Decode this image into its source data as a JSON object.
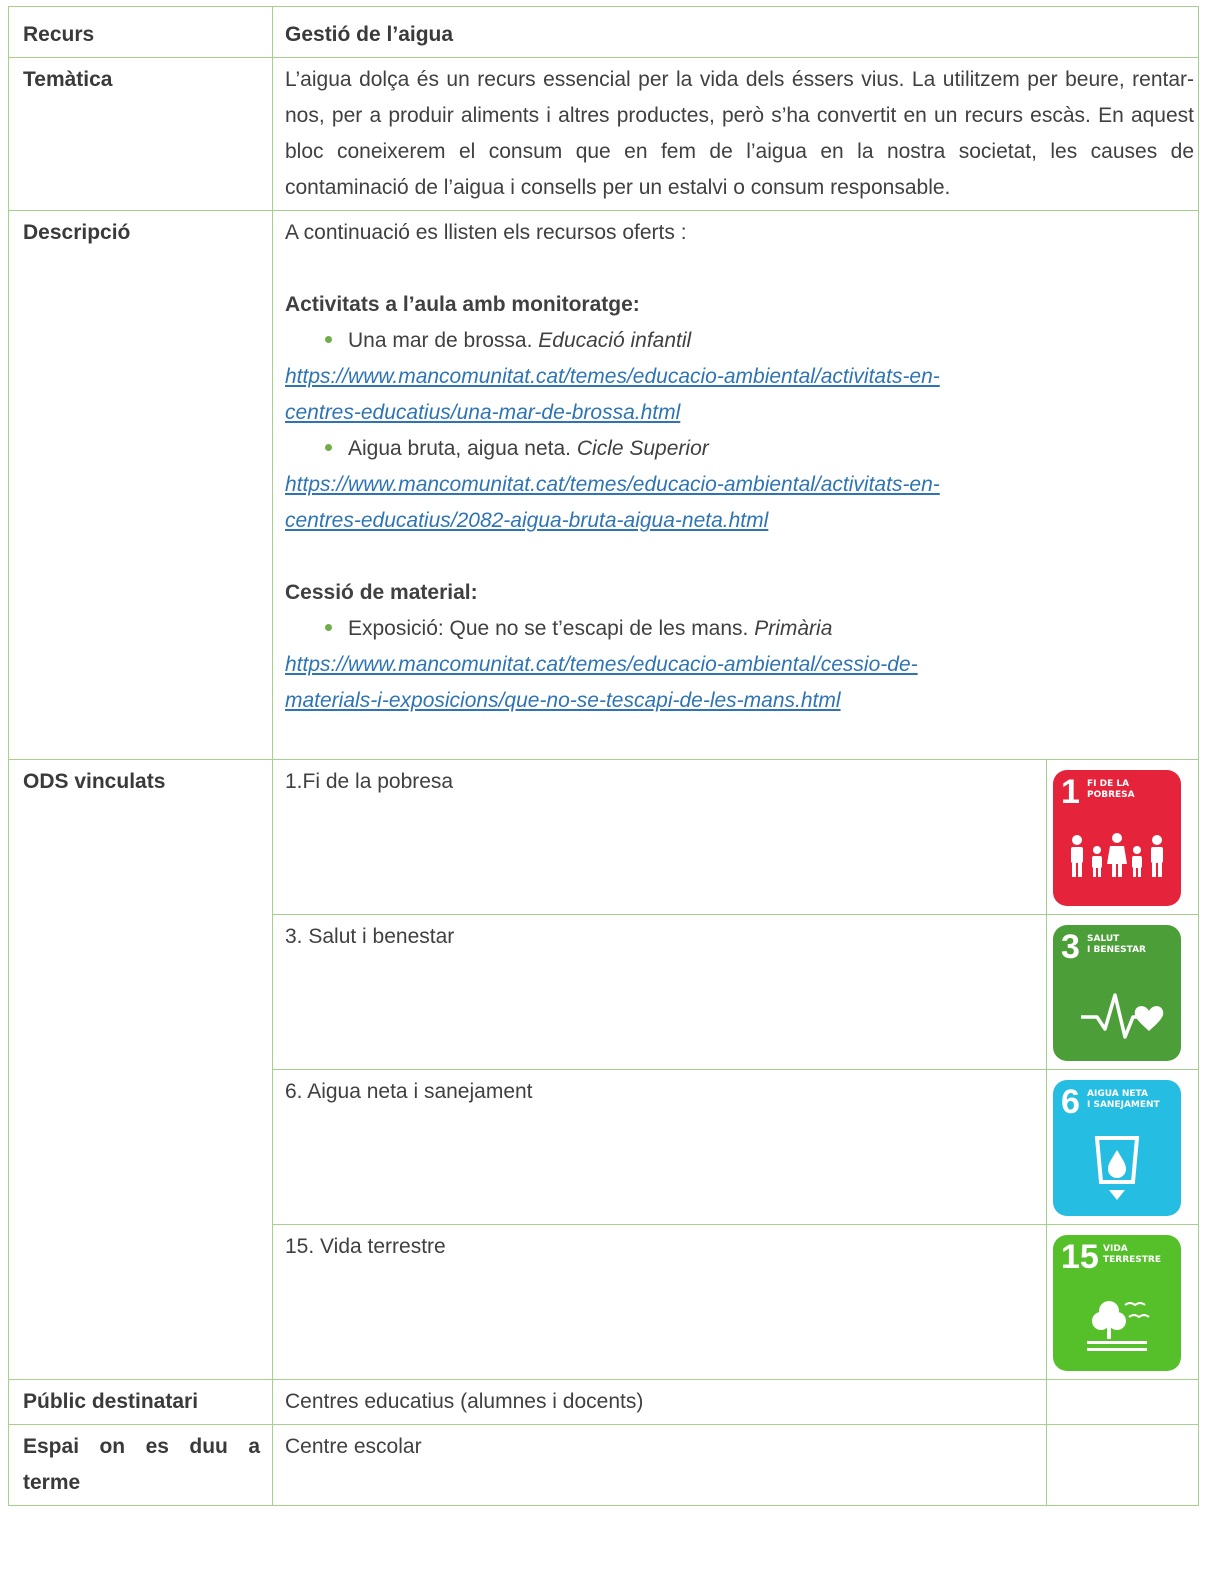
{
  "header": {
    "label": "Recurs",
    "value": "Gestió de l’aigua"
  },
  "tematica": {
    "label": "Temàtica",
    "text": "L’aigua dolça és un recurs essencial per la vida dels éssers vius. La utilitzem per beure, rentar-nos, per a produir aliments i altres productes, però s’ha convertit en un recurs escàs. En aquest bloc coneixerem el consum que en fem de l’aigua en la nostra societat, les causes de contaminació de l’aigua i consells per un estalvi o consum responsable."
  },
  "descripcio": {
    "label": "Descripció",
    "intro": "A continuació es llisten els recursos oferts :",
    "section1_title": "Activitats a l’aula amb monitoratge:",
    "item1_text": "Una mar de brossa.",
    "item1_level": "Educació infantil",
    "item1_link_line1": "https://www.mancomunitat.cat/temes/educacio-ambiental/activitats-en-",
    "item1_link_line2": "centres-educatius/una-mar-de-brossa.html",
    "item2_text": "Aigua bruta, aigua neta.",
    "item2_level": "Cicle Superior",
    "item2_link_line1": "https://www.mancomunitat.cat/temes/educacio-ambiental/activitats-en-",
    "item2_link_line2": "centres-educatius/2082-aigua-bruta-aigua-neta.html",
    "section2_title": "Cessió de material:",
    "item3_text": "Exposició: Que no se t’escapi de les mans.",
    "item3_level": "Primària",
    "item3_link_line1": "https://www.mancomunitat.cat/temes/educacio-ambiental/cessio-de-",
    "item3_link_line2": "materials-i-exposicions/que-no-se-tescapi-de-les-mans.html"
  },
  "ods": {
    "label": "ODS vinculats",
    "items": [
      {
        "text": "1.Fi de la pobresa",
        "num": "1",
        "badge_title_1": "FI DE LA",
        "badge_title_2": "POBRESA",
        "color": "#e5243b"
      },
      {
        "text": "3. Salut i benestar",
        "num": "3",
        "badge_title_1": "SALUT",
        "badge_title_2": "I BENESTAR",
        "color": "#4c9f38"
      },
      {
        "text": "6. Aigua neta i sanejament",
        "num": "6",
        "badge_title_1": "AIGUA NETA",
        "badge_title_2": "I SANEJAMENT",
        "color": "#26bde2"
      },
      {
        "text": "15. Vida terrestre",
        "num": "15",
        "badge_title_1": "VIDA",
        "badge_title_2": "TERRESTRE",
        "color": "#56c02b"
      }
    ]
  },
  "public": {
    "label": "Públic destinatari",
    "value": "Centres educatius (alumnes i docents)"
  },
  "espai": {
    "label": "Espai on es duu a terme",
    "value": "Centre escolar"
  },
  "colors": {
    "border": "#a8d08d",
    "link": "#2e74b5",
    "bullet": "#70ad47",
    "text": "#404040"
  }
}
